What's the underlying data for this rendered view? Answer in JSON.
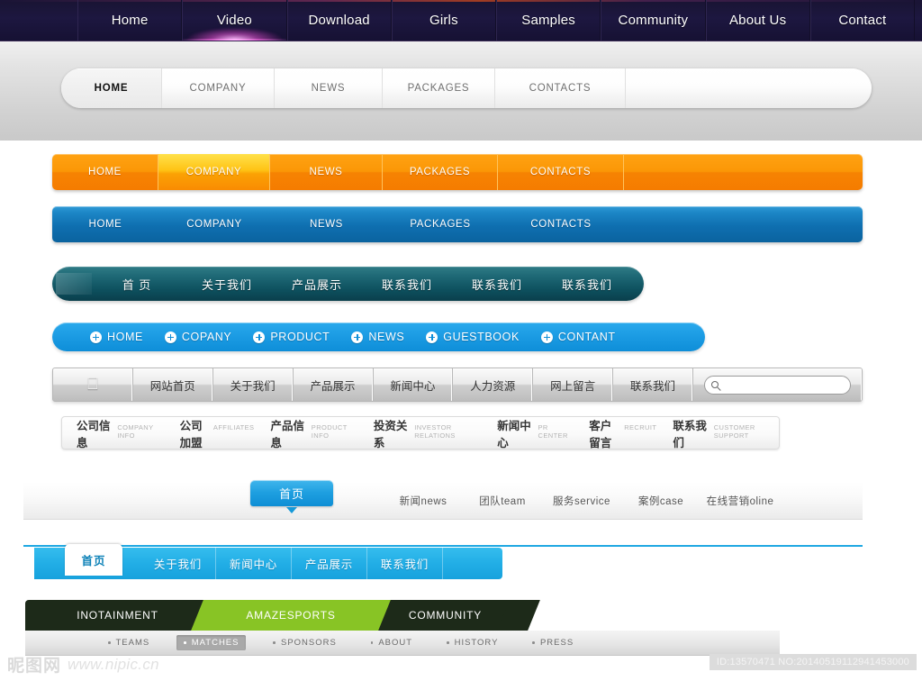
{
  "top_nav": {
    "items": [
      {
        "label": "Home",
        "active": false
      },
      {
        "label": "Video",
        "active": true
      },
      {
        "label": "Download",
        "active": false
      },
      {
        "label": "Girls",
        "active": false
      },
      {
        "label": "Samples",
        "active": false
      },
      {
        "label": "Community",
        "active": false
      },
      {
        "label": "About Us",
        "active": false
      },
      {
        "label": "Contact",
        "active": false
      }
    ],
    "accent_glow": "#ff8ef0",
    "background": "#1d1740"
  },
  "pill_nav": {
    "items": [
      {
        "label": "HOME",
        "active": true
      },
      {
        "label": "COMPANY",
        "active": false
      },
      {
        "label": "NEWS",
        "active": false
      },
      {
        "label": "PACKAGES",
        "active": false
      },
      {
        "label": "CONTACTS",
        "active": false
      }
    ]
  },
  "orange_nav": {
    "accent": "#f57c00",
    "items": [
      {
        "label": "HOME",
        "active": false
      },
      {
        "label": "COMPANY",
        "active": true
      },
      {
        "label": "NEWS",
        "active": false
      },
      {
        "label": "PACKAGES",
        "active": false
      },
      {
        "label": "CONTACTS",
        "active": false
      }
    ]
  },
  "blue_nav": {
    "accent": "#0f6fb0",
    "items": [
      {
        "label": "HOME",
        "active": false
      },
      {
        "label": "COMPANY",
        "active": false
      },
      {
        "label": "NEWS",
        "active": false
      },
      {
        "label": "PACKAGES",
        "active": false
      },
      {
        "label": "CONTACTS",
        "active": false
      }
    ]
  },
  "teal_nav": {
    "accent": "#0d4f5d",
    "items": [
      {
        "label": "首 页"
      },
      {
        "label": "关于我们"
      },
      {
        "label": "产品展示"
      },
      {
        "label": "联系我们"
      },
      {
        "label": "联系我们"
      },
      {
        "label": "联系我们"
      }
    ]
  },
  "cyan_plus_nav": {
    "accent": "#1c9ce4",
    "items": [
      {
        "label": "HOME",
        "icon": "plus-circle-icon"
      },
      {
        "label": "COPANY",
        "icon": "plus-circle-icon"
      },
      {
        "label": "PRODUCT",
        "icon": "plus-circle-icon"
      },
      {
        "label": "NEWS",
        "icon": "plus-circle-icon"
      },
      {
        "label": "GUESTBOOK",
        "icon": "plus-circle-icon"
      },
      {
        "label": "CONTANT",
        "icon": "plus-circle-icon"
      }
    ]
  },
  "grey_nav": {
    "logo_icon": "apple-logo-icon",
    "items": [
      {
        "label": "网站首页"
      },
      {
        "label": "关于我们"
      },
      {
        "label": "产品展示"
      },
      {
        "label": "新闻中心"
      },
      {
        "label": "人力资源"
      },
      {
        "label": "网上留言"
      },
      {
        "label": "联系我们"
      }
    ],
    "search": {
      "icon": "search-icon",
      "value": "",
      "placeholder": ""
    }
  },
  "bilingual_nav": {
    "items": [
      {
        "cn": "公司信息",
        "en": "COMPANY INFO"
      },
      {
        "cn": "公司加盟",
        "en": "AFFILIATES"
      },
      {
        "cn": "产品信息",
        "en": "PRODUCT INFO"
      },
      {
        "cn": "投资关系",
        "en": "INVESTOR RELATIONS"
      },
      {
        "cn": "新闻中心",
        "en": "PR CENTER"
      },
      {
        "cn": "客户留言",
        "en": "RECRUIT"
      },
      {
        "cn": "联系我们",
        "en": "CUSTOMER SUPPORT"
      }
    ]
  },
  "soft_nav": {
    "active": {
      "label": "首页",
      "accent": "#1e9fe0"
    },
    "items": [
      {
        "label": "新闻news"
      },
      {
        "label": "团队team"
      },
      {
        "label": "服务service"
      },
      {
        "label": "案例case"
      },
      {
        "label": "在线营销oline"
      }
    ]
  },
  "cyan_tab_nav": {
    "accent": "#1fa8e2",
    "active": {
      "label": "首页"
    },
    "items": [
      {
        "label": "关于我们"
      },
      {
        "label": "新闻中心"
      },
      {
        "label": "产品展示"
      },
      {
        "label": "联系我们"
      }
    ]
  },
  "sports_nav": {
    "dark": "#1d2a19",
    "green": "#88c425",
    "tabs": [
      {
        "label": "INOTAINMENT",
        "active": false
      },
      {
        "label": "AMAZESPORTS",
        "active": true
      },
      {
        "label": "COMMUNITY",
        "active": false
      }
    ],
    "sub_items": [
      {
        "label": "TEAMS",
        "active": false
      },
      {
        "label": "MATCHES",
        "active": true
      },
      {
        "label": "SPONSORS",
        "active": false
      },
      {
        "label": "ABOUT",
        "active": false
      },
      {
        "label": "HISTORY",
        "active": false
      },
      {
        "label": "PRESS",
        "active": false
      }
    ]
  },
  "footer": {
    "watermark_cn": "昵图网",
    "watermark_url": "www.nipic.cn",
    "id_tag": "ID:13570471 NO:20140519112941453000"
  }
}
